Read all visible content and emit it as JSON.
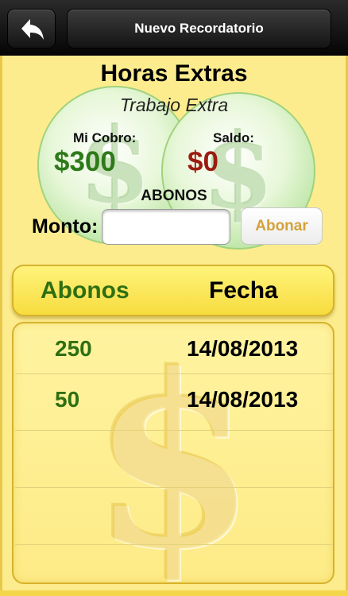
{
  "navbar": {
    "title": "Nuevo Recordatorio",
    "back_icon": "back-arrow-icon"
  },
  "summary": {
    "title": "Horas Extras",
    "subtitle": "Trabajo Extra",
    "cobro_label": "Mi Cobro:",
    "cobro_value": "$300",
    "saldo_label": "Saldo:",
    "saldo_value": "$0",
    "abonos_heading": "ABONOS"
  },
  "payment": {
    "monto_label": "Monto:",
    "monto_value": "",
    "monto_placeholder": "",
    "abonar_label": "Abonar"
  },
  "table": {
    "columns": [
      "Abonos",
      "Fecha"
    ],
    "rows": [
      {
        "amount": "250",
        "date": "14/08/2013"
      },
      {
        "amount": "50",
        "date": "14/08/2013"
      }
    ]
  },
  "colors": {
    "background": "#fdec8e",
    "green_text": "#2e6f12",
    "red_text": "#9b1c10",
    "button_text": "#d4a23a"
  }
}
